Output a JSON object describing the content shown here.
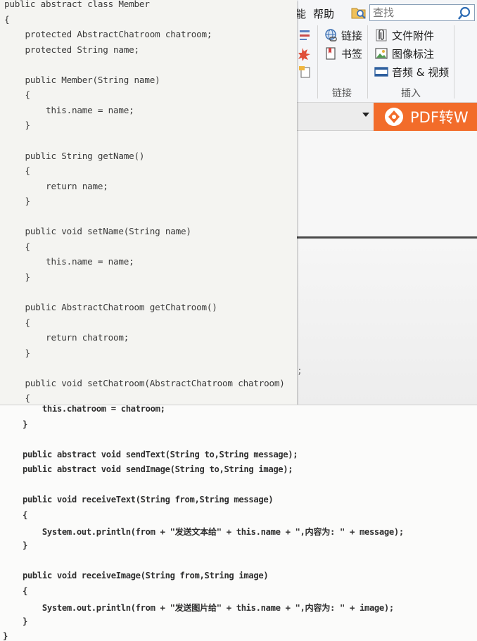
{
  "app": {
    "menu": [
      "能",
      "帮助"
    ],
    "search": {
      "placeholder": "查找"
    },
    "ribbon": {
      "link_group": {
        "items": [
          "链接",
          "书签"
        ],
        "label": "链接"
      },
      "insert_group": {
        "items": [
          "文件附件",
          "图像标注",
          "音频 & 视频"
        ],
        "label": "插入"
      }
    },
    "pdf_convert_button": "PDF转W",
    "stray_text": ";"
  },
  "code_top": {
    "lines": [
      "public abstract class Member",
      "{",
      "    protected AbstractChatroom chatroom;",
      "    protected String name;",
      "",
      "    public Member(String name)",
      "    {",
      "        this.name = name;",
      "    }",
      "",
      "    public String getName()",
      "    {",
      "        return name;",
      "    }",
      "",
      "    public void setName(String name)",
      "    {",
      "        this.name = name;",
      "    }",
      "",
      "    public AbstractChatroom getChatroom()",
      "    {",
      "        return chatroom;",
      "    }",
      "",
      "    public void setChatroom(AbstractChatroom chatroom)",
      "    {"
    ]
  },
  "code_bottom": {
    "lines": [
      "        this.chatroom = chatroom;",
      "    }",
      "",
      "    public abstract void sendText(String to,String message);",
      "    public abstract void sendImage(String to,String image);",
      "",
      "    public void receiveText(String from,String message)",
      "    {",
      "        System.out.println(from + \"发送文本给\" + this.name + \",内容为: \" + message);",
      "    }",
      "",
      "    public void receiveImage(String from,String image)",
      "    {",
      "        System.out.println(from + \"发送图片给\" + this.name + \",内容为: \" + image);",
      "    }",
      "}"
    ]
  },
  "colors": {
    "pdf_button": "#f26c2a",
    "ribbon_bg": "#f5f6f8",
    "panel_bg": "#f4f4f1"
  }
}
